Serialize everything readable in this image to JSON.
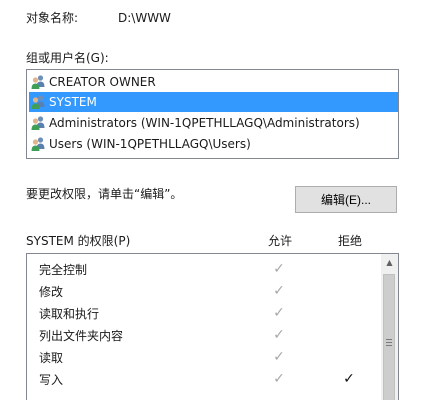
{
  "object": {
    "label": "对象名称:",
    "value": "D:\\WWW"
  },
  "groups": {
    "label": "组或用户名(G):",
    "items": [
      {
        "label": "CREATOR OWNER",
        "icon": "user-group-icon",
        "selected": false
      },
      {
        "label": "SYSTEM",
        "icon": "user-group-icon",
        "selected": true
      },
      {
        "label": "Administrators (WIN-1QPETHLLAGQ\\Administrators)",
        "icon": "user-group-icon",
        "selected": false
      },
      {
        "label": "Users (WIN-1QPETHLLAGQ\\Users)",
        "icon": "user-group-icon",
        "selected": false
      }
    ]
  },
  "change_hint": "要更改权限，请单击“编辑”。",
  "edit_button": "编辑(E)...",
  "permissions": {
    "title": "SYSTEM 的权限(P)",
    "allow_header": "允许",
    "deny_header": "拒绝",
    "rows": [
      {
        "name": "完全控制",
        "allow": true,
        "deny": false
      },
      {
        "name": "修改",
        "allow": true,
        "deny": false
      },
      {
        "name": "读取和执行",
        "allow": true,
        "deny": false
      },
      {
        "name": "列出文件夹内容",
        "allow": true,
        "deny": false
      },
      {
        "name": "读取",
        "allow": true,
        "deny": false
      },
      {
        "name": "写入",
        "allow": true,
        "deny": true
      }
    ]
  },
  "check_glyph": "✓",
  "colors": {
    "selection": "#3399ff",
    "allow_check": "#a8a8a8",
    "deny_check": "#111111"
  }
}
